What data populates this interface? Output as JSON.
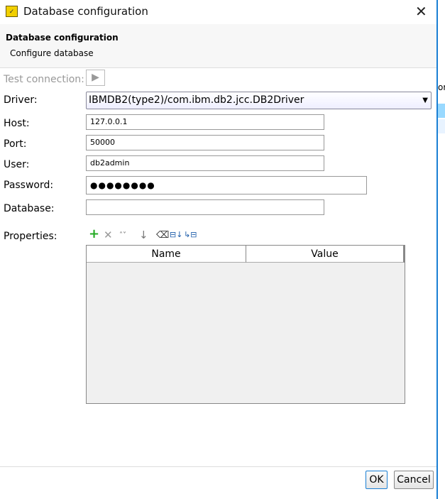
{
  "window": {
    "title": "Database configuration",
    "icon": "app-icon"
  },
  "header": {
    "title": "Database configuration",
    "subtitle": "Configure database"
  },
  "form": {
    "test_connection_label": "Test connection:",
    "driver_label": "Driver:",
    "driver_value": "IBMDB2(type2)/com.ibm.db2.jcc.DB2Driver",
    "host_label": "Host:",
    "host_value": "127.0.0.1",
    "port_label": "Port:",
    "port_value": "50000",
    "user_label": "User:",
    "user_value": "db2admin",
    "password_label": "Password:",
    "password_value": "●●●●●●●●",
    "database_label": "Database:",
    "database_value": "",
    "properties_label": "Properties:"
  },
  "properties_table": {
    "columns": [
      "Name",
      "Value"
    ],
    "rows": []
  },
  "toolbar": [
    "add-icon",
    "delete-icon",
    "move-up-down-icon",
    "move-down-icon",
    "clear-icon",
    "import-icon",
    "export-icon"
  ],
  "footer": {
    "ok": "OK",
    "cancel": "Cancel"
  },
  "background": {
    "partial_text": "or"
  }
}
